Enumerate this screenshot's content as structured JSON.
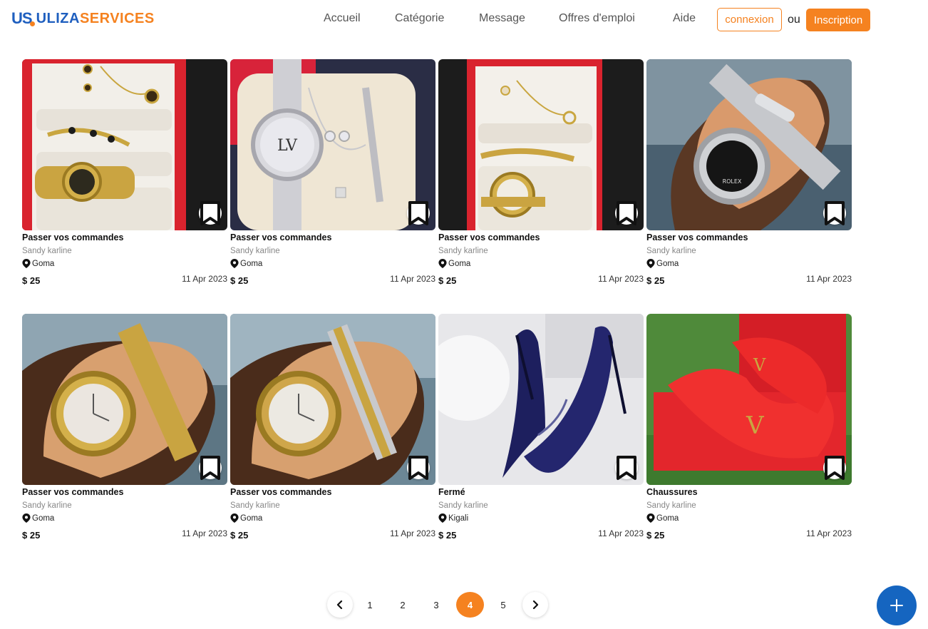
{
  "brand": {
    "mark": "US",
    "name_part1": "ULIZA",
    "name_part2": "SERVICES",
    "primary_color": "#1f5fbf",
    "accent_color": "#f58220"
  },
  "nav": {
    "items": [
      "Accueil",
      "Catégorie",
      "Message",
      "Offres d'emploi",
      "Aide"
    ]
  },
  "auth": {
    "login_label": "connexion",
    "or_label": "ou",
    "signup_label": "Inscription"
  },
  "listings": [
    {
      "title": "Passer vos commandes",
      "seller": "Sandy karline",
      "location": "Goma",
      "price": "$ 25",
      "date": "11 Apr 2023"
    },
    {
      "title": "Passer vos commandes",
      "seller": "Sandy karline",
      "location": "Goma",
      "price": "$ 25",
      "date": "11 Apr 2023"
    },
    {
      "title": "Passer vos commandes",
      "seller": "Sandy karline",
      "location": "Goma",
      "price": "$ 25",
      "date": "11 Apr 2023"
    },
    {
      "title": "Passer vos commandes",
      "seller": "Sandy karline",
      "location": "Goma",
      "price": "$ 25",
      "date": "11 Apr 2023"
    },
    {
      "title": "Passer vos commandes",
      "seller": "Sandy karline",
      "location": "Goma",
      "price": "$ 25",
      "date": "11 Apr 2023"
    },
    {
      "title": "Passer vos commandes",
      "seller": "Sandy karline",
      "location": "Goma",
      "price": "$ 25",
      "date": "11 Apr 2023"
    },
    {
      "title": "Fermé",
      "seller": "Sandy karline",
      "location": "Kigali",
      "price": "$ 25",
      "date": "11 Apr 2023"
    },
    {
      "title": "Chaussures",
      "seller": "Sandy karline",
      "location": "Goma",
      "price": "$ 25",
      "date": "11 Apr 2023"
    }
  ],
  "pagination": {
    "prev_icon": "chevron-left-icon",
    "next_icon": "chevron-right-icon",
    "pages": [
      "1",
      "2",
      "3",
      "4",
      "5"
    ],
    "current": "4"
  },
  "fab": {
    "icon": "plus-icon",
    "color": "#1565c0"
  }
}
